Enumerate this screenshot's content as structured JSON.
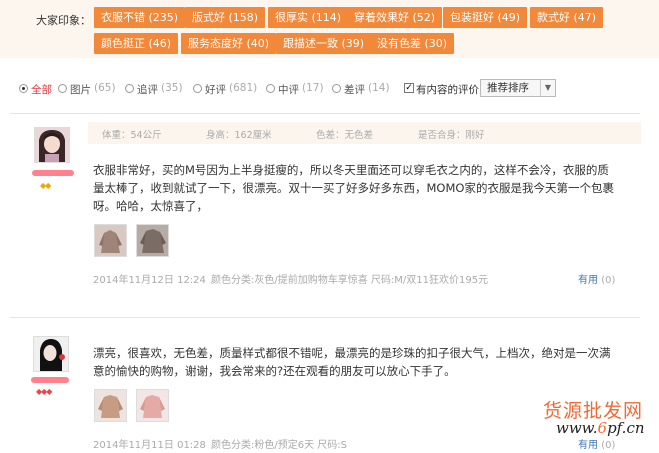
{
  "impressions": {
    "label": "大家印象：",
    "tags": [
      "衣服不错 (235)",
      "版式好 (158)",
      "很厚实 (114)",
      "穿着效果好 (52)",
      "包装挺好 (49)",
      "款式好 (47)",
      "颜色挺正 (46)",
      "服务态度好 (40)",
      "跟描述一致 (39)",
      "没有色差 (30)"
    ]
  },
  "filters": {
    "options": [
      {
        "label": "全部",
        "count": "",
        "selected": true
      },
      {
        "label": "图片",
        "count": "(65)",
        "selected": false
      },
      {
        "label": "追评",
        "count": "(35)",
        "selected": false
      },
      {
        "label": "好评",
        "count": "(681)",
        "selected": false
      },
      {
        "label": "中评",
        "count": "(17)",
        "selected": false
      },
      {
        "label": "差评",
        "count": "(14)",
        "selected": false
      }
    ],
    "content_only_label": "有内容的评价",
    "content_only_checked": true,
    "sort_value": "推荐排序"
  },
  "reviews": [
    {
      "info": [
        "体重：54公斤",
        "身高：162厘米",
        "色差：无色差",
        "是否合身：刚好"
      ],
      "text_lines": [
        "衣服非常好，买的M号因为上半身挺瘦的，所以冬天里面还可以穿毛衣之内的，这样不会冷，衣服的质",
        "量太棒了，收到就试了一下，很漂亮。双十一买了好多好多东西，MOMO家的衣服是我今天第一个包裹",
        "呀。哈哈，太惊喜了，"
      ],
      "date": "2014年11月12日 12:24",
      "sku": "颜色分类:灰色/提前加购物车享惊喜  尺码:M/双11狂欢价195元",
      "useful_label": "有用",
      "useful_count": "(0)",
      "gem_icons": "◆◆"
    },
    {
      "text_lines": [
        "漂亮，很喜欢，无色差，质量样式都很不错呢，最漂亮的是珍珠的扣子很大气，上档次，绝对是一次满",
        "意的愉快的购物，谢谢，我会常来的?还在观看的朋友可以放心下手了。"
      ],
      "date": "2014年11月11日 01:28",
      "sku": "颜色分类:粉色/预定6天  尺码:S",
      "useful_label": "有用",
      "useful_count": "(0)",
      "gem_icons": "◆◆◆"
    }
  ],
  "watermark": {
    "cn": "货源批发网",
    "url_pre": "www.",
    "url_num": "6",
    "url_post": "pf.cn"
  },
  "colors": {
    "tag_bg": "#f1883a",
    "accent_red": "#e4393c",
    "link_blue": "#3d7ab8"
  }
}
